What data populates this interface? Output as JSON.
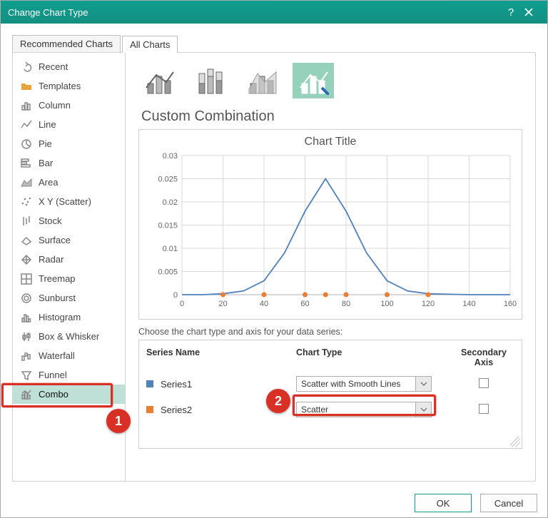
{
  "title": "Change Chart Type",
  "tabs": {
    "recommended": "Recommended Charts",
    "all": "All Charts"
  },
  "activeTab": "all",
  "sidebar": {
    "items": [
      {
        "id": "recent",
        "label": "Recent",
        "icon": "undo"
      },
      {
        "id": "templates",
        "label": "Templates",
        "icon": "folder"
      },
      {
        "id": "column",
        "label": "Column",
        "icon": "column"
      },
      {
        "id": "line",
        "label": "Line",
        "icon": "line"
      },
      {
        "id": "pie",
        "label": "Pie",
        "icon": "pie"
      },
      {
        "id": "bar",
        "label": "Bar",
        "icon": "bar"
      },
      {
        "id": "area",
        "label": "Area",
        "icon": "area"
      },
      {
        "id": "xy",
        "label": "X Y (Scatter)",
        "icon": "scatter"
      },
      {
        "id": "stock",
        "label": "Stock",
        "icon": "stock"
      },
      {
        "id": "surface",
        "label": "Surface",
        "icon": "surface"
      },
      {
        "id": "radar",
        "label": "Radar",
        "icon": "radar"
      },
      {
        "id": "treemap",
        "label": "Treemap",
        "icon": "treemap"
      },
      {
        "id": "sunburst",
        "label": "Sunburst",
        "icon": "sunburst"
      },
      {
        "id": "histogram",
        "label": "Histogram",
        "icon": "histogram"
      },
      {
        "id": "boxwhisker",
        "label": "Box & Whisker",
        "icon": "boxwhisker"
      },
      {
        "id": "waterfall",
        "label": "Waterfall",
        "icon": "waterfall"
      },
      {
        "id": "funnel",
        "label": "Funnel",
        "icon": "funnel"
      },
      {
        "id": "combo",
        "label": "Combo",
        "icon": "combo",
        "selected": true
      }
    ]
  },
  "mainHeading": "Custom Combination",
  "subtypeSelected": 3,
  "chooseLabel": "Choose the chart type and axis for your data series:",
  "table": {
    "headers": {
      "name": "Series Name",
      "type": "Chart Type",
      "secondary": "Secondary Axis"
    },
    "rows": [
      {
        "name": "Series1",
        "color": "#4f81bd",
        "type": "Scatter with Smooth Lines",
        "secondary": false
      },
      {
        "name": "Series2",
        "color": "#ed7d31",
        "type": "Scatter",
        "secondary": false,
        "highlighted": true
      }
    ]
  },
  "buttons": {
    "ok": "OK",
    "cancel": "Cancel"
  },
  "callouts": {
    "combo": "1",
    "series2": "2"
  },
  "chart_data": {
    "type": "line",
    "title": "Chart Title",
    "xlabel": "",
    "ylabel": "",
    "xlim": [
      0,
      160
    ],
    "ylim": [
      0,
      0.03
    ],
    "x": [
      0,
      20,
      40,
      60,
      70,
      80,
      100,
      120,
      140,
      160
    ],
    "series": [
      {
        "name": "Series1",
        "color": "#4f81bd",
        "x": [
          0,
          10,
          20,
          30,
          40,
          50,
          60,
          70,
          80,
          90,
          100,
          110,
          120,
          140,
          160
        ],
        "y": [
          0,
          0,
          0.0002,
          0.0008,
          0.003,
          0.009,
          0.018,
          0.025,
          0.018,
          0.009,
          0.003,
          0.0008,
          0.0002,
          0,
          0
        ]
      },
      {
        "name": "Series2",
        "color": "#ed7d31",
        "marker": "dot",
        "x": [
          20,
          40,
          60,
          70,
          80,
          100,
          120
        ],
        "y": [
          0,
          0,
          0,
          0,
          0,
          0,
          0
        ]
      }
    ],
    "yticks": [
      0,
      0.005,
      0.01,
      0.015,
      0.02,
      0.025,
      0.03
    ],
    "ytick_labels": [
      "0",
      "0.005",
      "0.01",
      "0.015",
      "0.02",
      "0.025",
      "0.03"
    ],
    "xticks": [
      0,
      20,
      40,
      60,
      80,
      100,
      120,
      140,
      160
    ]
  }
}
